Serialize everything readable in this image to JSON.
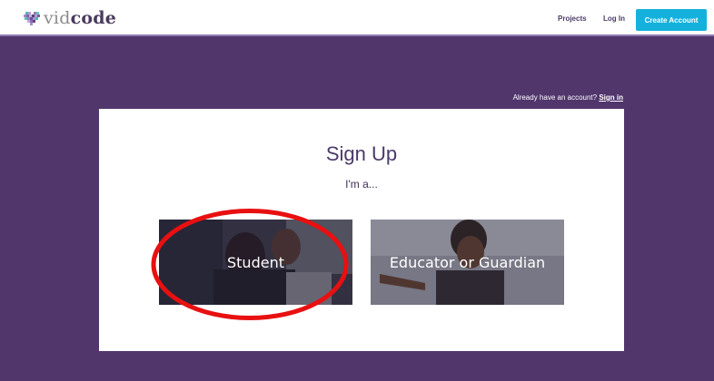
{
  "brand": {
    "logo_text_light": "vid",
    "logo_text_bold": "code"
  },
  "header": {
    "projects_label": "Projects",
    "login_label": "Log In",
    "create_account_label": "Create Account"
  },
  "signin_prompt": {
    "text": "Already have an account?",
    "link": "Sign in"
  },
  "signup": {
    "title": "Sign Up",
    "subtitle": "I'm a...",
    "options": [
      {
        "label": "Student"
      },
      {
        "label": "Educator or Guardian"
      }
    ]
  },
  "colors": {
    "purple_bg": "#51366c",
    "accent_blue": "#14b1dd",
    "annotation_red": "#e81010"
  }
}
